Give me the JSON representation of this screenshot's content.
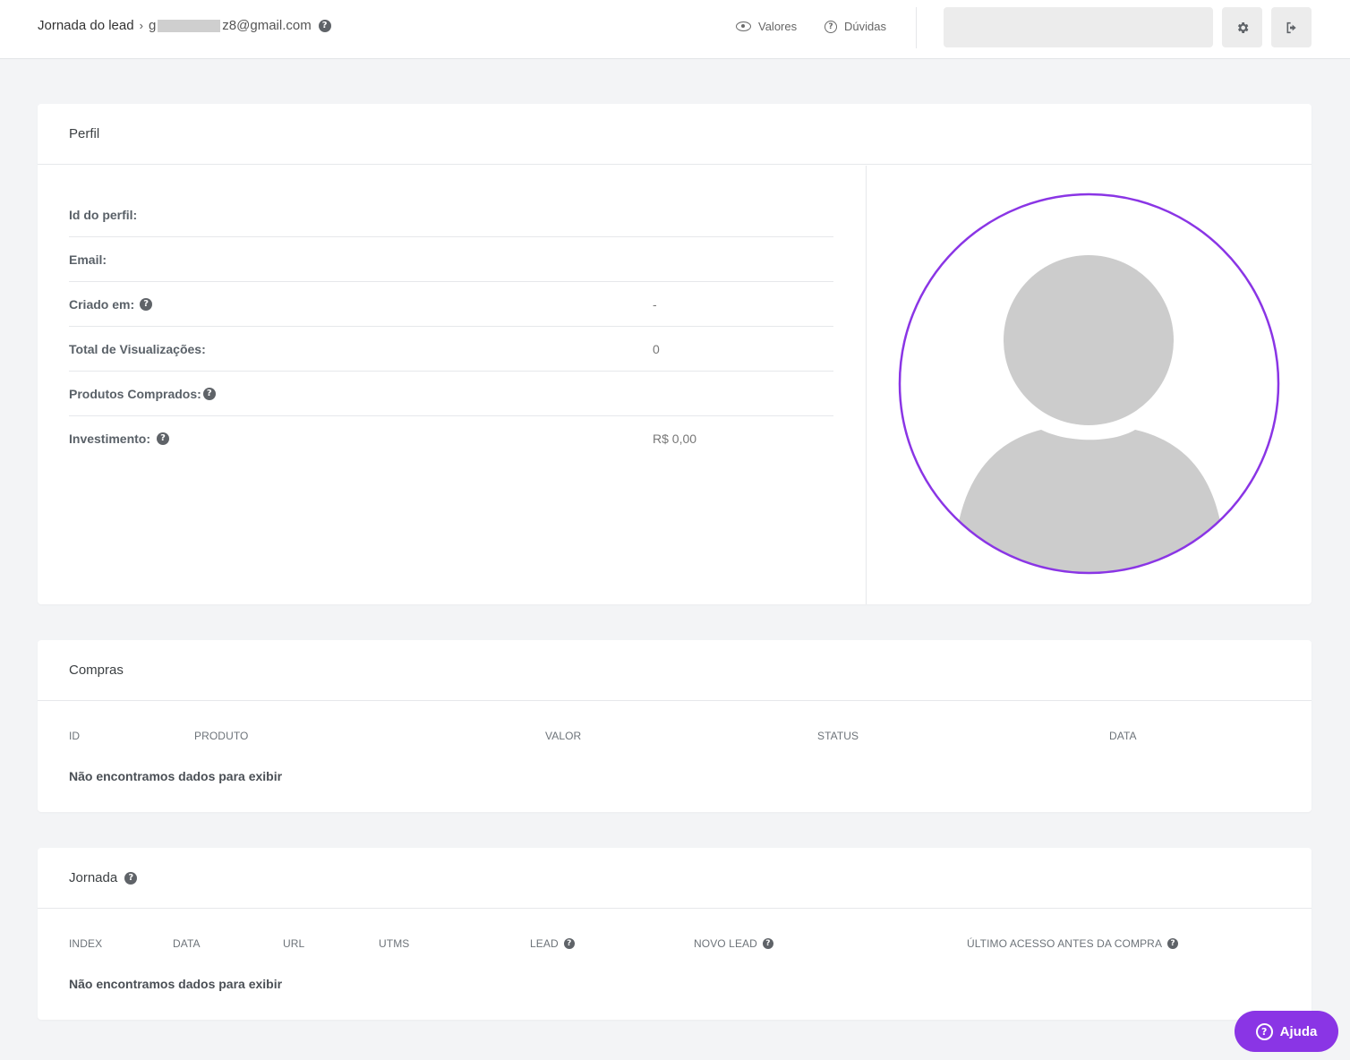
{
  "header": {
    "breadcrumb_root": "Jornada do lead",
    "email_start": "g",
    "email_end": "z8@gmail.com",
    "nav": {
      "values_label": "Valores",
      "help_label": "Dúvidas"
    },
    "icons": [
      "eye-icon",
      "question-circle-icon",
      "gear-icon",
      "logout-icon"
    ]
  },
  "profile": {
    "title": "Perfil",
    "fields": [
      {
        "label": "Id do perfil:",
        "value": ""
      },
      {
        "label": "Email:",
        "value": ""
      },
      {
        "label": "Criado em:",
        "value": "-"
      },
      {
        "label": "Total de Visualizações:",
        "value": "0"
      },
      {
        "label": "Produtos Comprados:",
        "value": ""
      },
      {
        "label": "Investimento:",
        "value": "R$ 0,00"
      }
    ],
    "avatar_border_color": "#8a35e5"
  },
  "purchases": {
    "title": "Compras",
    "columns": [
      "ID",
      "PRODUTO",
      "VALOR",
      "STATUS",
      "DATA"
    ],
    "empty_text": "Não encontramos dados para exibir"
  },
  "journey": {
    "title": "Jornada",
    "columns": [
      "INDEX",
      "DATA",
      "URL",
      "UTMS",
      "LEAD",
      "NOVO LEAD",
      "ÚLTIMO ACESSO ANTES DA COMPRA"
    ],
    "empty_text": "Não encontramos dados para exibir"
  },
  "help_button": {
    "label": "Ajuda",
    "color": "#8a35e5"
  }
}
